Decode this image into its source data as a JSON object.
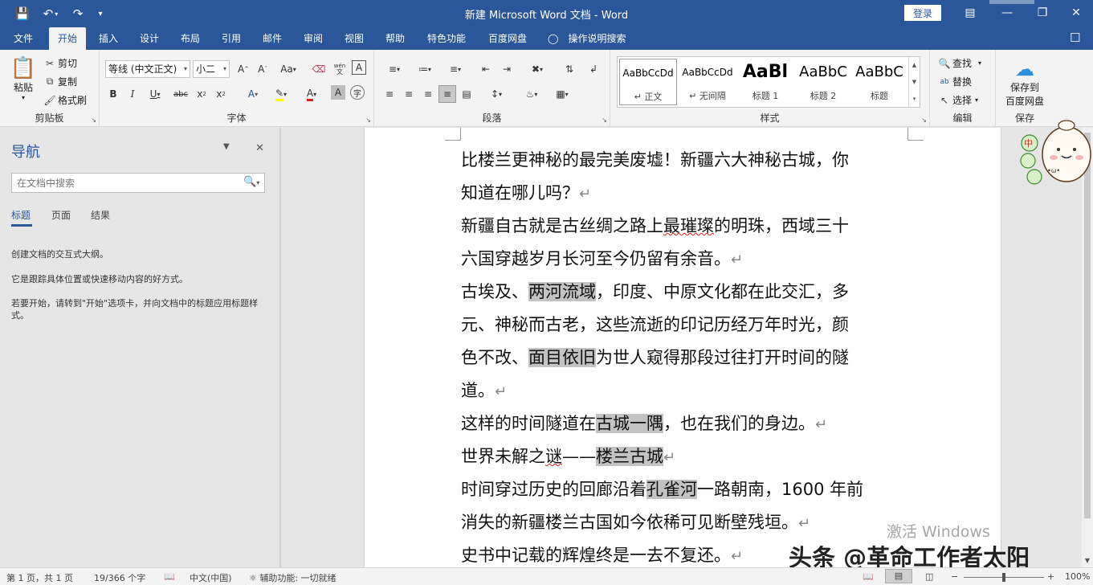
{
  "window": {
    "title": "新建 Microsoft Word 文档  -  Word",
    "login_label": "登录",
    "quick_access": [
      "save-icon",
      "undo-icon",
      "redo-icon",
      "customize-icon"
    ]
  },
  "tabs": [
    "文件",
    "开始",
    "插入",
    "设计",
    "布局",
    "引用",
    "邮件",
    "审阅",
    "视图",
    "帮助",
    "特色功能",
    "百度网盘"
  ],
  "active_tab": "开始",
  "tell_me": "操作说明搜索",
  "ribbon": {
    "clipboard": {
      "paste": "粘贴",
      "cut": "剪切",
      "copy": "复制",
      "format_painter": "格式刷",
      "label": "剪贴板"
    },
    "font": {
      "font_name": "等线 (中文正文)",
      "font_size": "小二",
      "label": "字体",
      "wen": "wén"
    },
    "paragraph": {
      "label": "段落"
    },
    "styles": {
      "label": "样式",
      "items": [
        {
          "preview": "AaBbCcDd",
          "name": "↵ 正文"
        },
        {
          "preview": "AaBbCcDd",
          "name": "↵ 无间隔"
        },
        {
          "preview": "AaBl",
          "name": "标题 1"
        },
        {
          "preview": "AaBbC",
          "name": "标题 2"
        },
        {
          "preview": "AaBbC",
          "name": "标题"
        }
      ]
    },
    "editing": {
      "find": "查找",
      "replace": "替换",
      "select": "选择",
      "label": "编辑"
    },
    "save": {
      "line1": "保存到",
      "line2": "百度网盘",
      "label": "保存"
    }
  },
  "nav": {
    "title": "导航",
    "search_placeholder": "在文档中搜索",
    "tabs": [
      "标题",
      "页面",
      "结果"
    ],
    "text1": "创建文档的交互式大纲。",
    "text2": "它是跟踪具体位置或快速移动内容的好方式。",
    "text3": "若要开始，请转到\"开始\"选项卡，并向文档中的标题应用标题样式。"
  },
  "document": {
    "lines": [
      [
        {
          "t": "比楼兰更神秘的最完美废墟！新疆六大神秘古城，你"
        }
      ],
      [
        {
          "t": "知道在哪儿吗？"
        },
        {
          "t": "↵",
          "c": "pm"
        }
      ],
      [
        {
          "t": "新疆自古就是古丝绸之路上"
        },
        {
          "t": "最璀璨",
          "c": "squig"
        },
        {
          "t": "的明珠，西域三十"
        }
      ],
      [
        {
          "t": "六国穿越岁月长河至今仍留有余音。"
        },
        {
          "t": "↵",
          "c": "pm"
        }
      ],
      [
        {
          "t": "古埃及、"
        },
        {
          "t": "两河流域",
          "c": "hl"
        },
        {
          "t": "，印度、中原文化都在此交汇，多"
        }
      ],
      [
        {
          "t": "元、神秘而古老，这些流逝的印记历经万年时光，颜"
        }
      ],
      [
        {
          "t": "色不改、"
        },
        {
          "t": "面目依旧",
          "c": "hl"
        },
        {
          "t": "为世人窥得那段过往打开时间的隧"
        }
      ],
      [
        {
          "t": "道。"
        },
        {
          "t": "↵",
          "c": "pm"
        }
      ],
      [
        {
          "t": "这样的时间隧道在"
        },
        {
          "t": "古城一隅",
          "c": "hl"
        },
        {
          "t": "，也在我们的身边。"
        },
        {
          "t": "↵",
          "c": "pm"
        }
      ],
      [
        {
          "t": "世界未解之"
        },
        {
          "t": "谜",
          "c": "squig"
        },
        {
          "t": "——"
        },
        {
          "t": "楼兰古城",
          "c": "hl"
        },
        {
          "t": "↵",
          "c": "pm"
        }
      ],
      [
        {
          "t": "时间穿过历史的回廊沿着"
        },
        {
          "t": "孔雀河",
          "c": "hl"
        },
        {
          "t": "一路朝南，1600 年前"
        }
      ],
      [
        {
          "t": "消失的新疆楼兰古国如今依稀可见断壁残垣。"
        },
        {
          "t": "↵",
          "c": "pm"
        }
      ],
      [
        {
          "t": "史书中记载的辉煌终是一去不复还。"
        },
        {
          "t": "↵",
          "c": "pm"
        }
      ]
    ]
  },
  "watermarks": {
    "activate": "激活 Windows",
    "author": "头条 @革命工作者太阳"
  },
  "sticker": {
    "badge1": "中",
    "badge2": "•ω•"
  },
  "status": {
    "page": "第 1 页，共 1 页",
    "words": "19/366 个字",
    "language": "中文(中国)",
    "accessibility": "辅助功能: 一切就绪",
    "zoom": "100%",
    "zoom_minus": "−",
    "zoom_plus": "+"
  },
  "colors": {
    "accent": "#2b579a",
    "highlight": "#c3c3c3",
    "font_color": "#e02020",
    "highlight_marker": "#ffff00"
  }
}
